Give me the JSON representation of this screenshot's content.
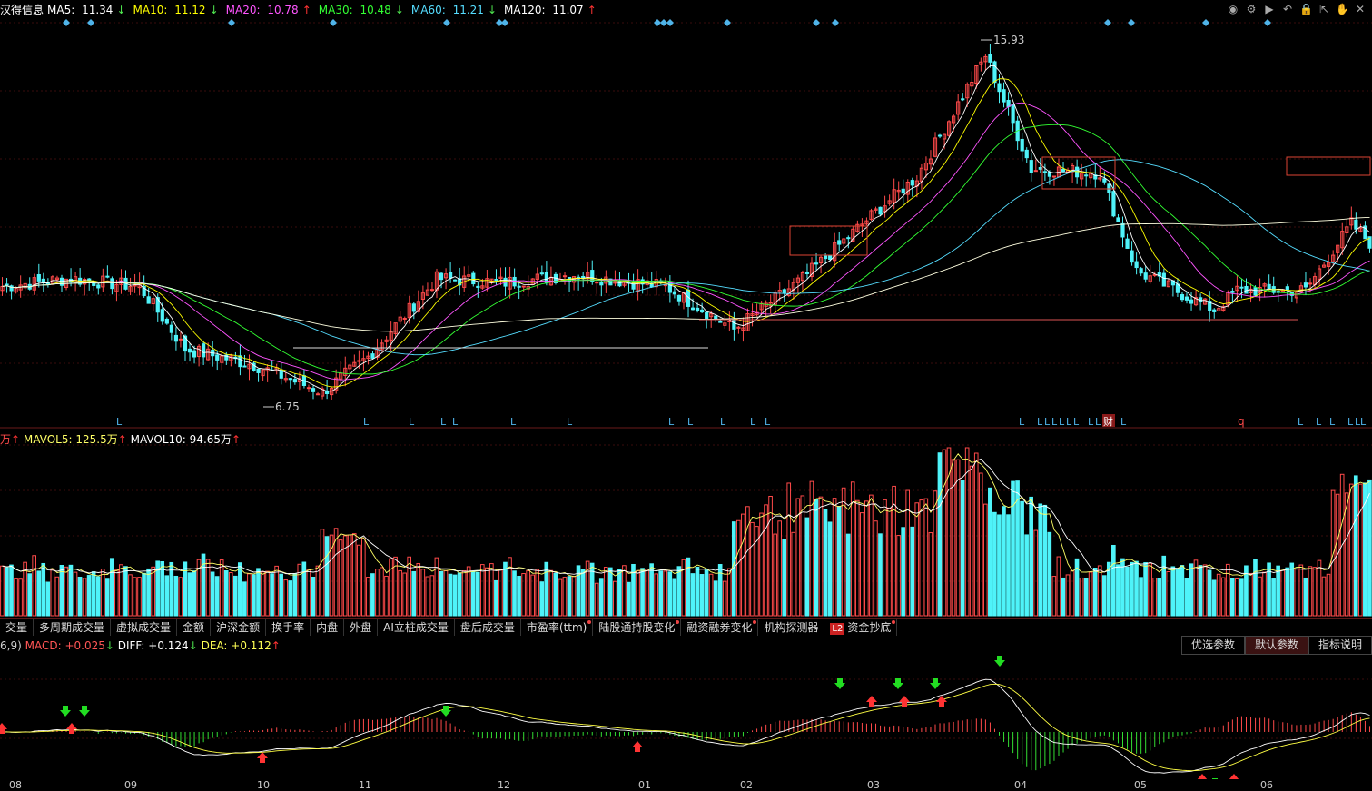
{
  "stock": {
    "name": "汉得信息"
  },
  "ma": [
    {
      "label": "MA5:",
      "value": "11.34",
      "dir": "↓",
      "color": "#ffffff",
      "dcolor": "#4ee64e"
    },
    {
      "label": "MA10:",
      "value": "11.12",
      "dir": "↓",
      "color": "#ffff00",
      "dcolor": "#4ee64e"
    },
    {
      "label": "MA20:",
      "value": "10.78",
      "dir": "↑",
      "color": "#ff55ff",
      "dcolor": "#ff3333"
    },
    {
      "label": "MA30:",
      "value": "10.48",
      "dir": "↓",
      "color": "#33ff33",
      "dcolor": "#4ee64e"
    },
    {
      "label": "MA60:",
      "value": "11.21",
      "dir": "↓",
      "color": "#55ddff",
      "dcolor": "#4ee64e"
    },
    {
      "label": "MA120:",
      "value": "11.07",
      "dir": "↑",
      "color": "#ffffff",
      "dcolor": "#ff3333"
    }
  ],
  "price_labels": {
    "high": "15.93",
    "low": "6.75"
  },
  "signals": {
    "marker": "L",
    "q_marker": "q",
    "cai": "财"
  },
  "volume": {
    "prefix": "万",
    "up": "↑",
    "mavol5_label": "MAVOL5:",
    "mavol5": "125.5万",
    "mavol10_label": "MAVOL10:",
    "mavol10": "94.65万"
  },
  "tabs": [
    {
      "label": "交量",
      "dot": false
    },
    {
      "label": "多周期成交量",
      "dot": false
    },
    {
      "label": "虚拟成交量",
      "dot": false
    },
    {
      "label": "金额",
      "dot": false
    },
    {
      "label": "沪深金额",
      "dot": false
    },
    {
      "label": "换手率",
      "dot": false
    },
    {
      "label": "内盘",
      "dot": false
    },
    {
      "label": "外盘",
      "dot": false
    },
    {
      "label": "AI立桩成交量",
      "dot": false
    },
    {
      "label": "盘后成交量",
      "dot": false
    },
    {
      "label": "市盈率(ttm)",
      "dot": true
    },
    {
      "label": "陆股通持股变化",
      "dot": true
    },
    {
      "label": "融资融券变化",
      "dot": true
    },
    {
      "label": "机构探测器",
      "dot": false
    },
    {
      "label": "资金抄底",
      "dot": true,
      "badge": "L2"
    }
  ],
  "macd": {
    "params": "6,9)",
    "macd_label": "MACD:",
    "macd": "+0.025",
    "macd_dir": "↓",
    "diff_label": "DIFF:",
    "diff": "+0.124",
    "diff_dir": "↓",
    "dea_label": "DEA:",
    "dea": "+0.112",
    "dea_dir": "↑"
  },
  "param_buttons": {
    "optimize": "优选参数",
    "default": "默认参数",
    "help": "指标说明"
  },
  "xaxis": [
    "08",
    "09",
    "10",
    "11",
    "12",
    "01",
    "02",
    "03",
    "04",
    "05",
    "06"
  ],
  "colors": {
    "up": "#ff4a4a",
    "down": "#4ff3f9",
    "ma5": "#ffffff",
    "ma10": "#ffff00",
    "ma20": "#ff55ff",
    "ma30": "#33ff33",
    "ma60": "#55ddff",
    "ma120": "#ffffe0"
  }
}
